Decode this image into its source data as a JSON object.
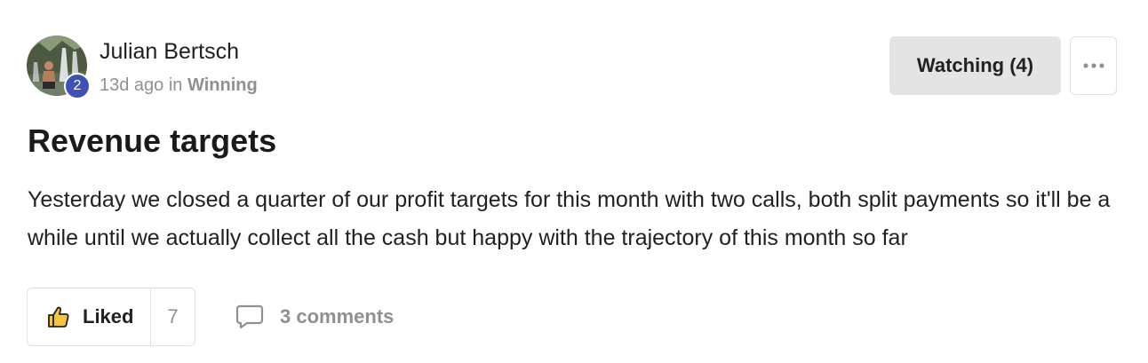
{
  "post": {
    "author": {
      "name": "Julian Bertsch",
      "level": "2",
      "avatar": "waterfall-photo-avatar"
    },
    "meta": {
      "time": "13d ago",
      "in_word": "in",
      "category": "Winning"
    },
    "actions": {
      "watching_label": "Watching (4)",
      "more_icon": "ellipsis-icon"
    },
    "title": "Revenue targets",
    "body": "Yesterday we closed a quarter of our profit targets for this month with two calls, both split payments so it'll be a while until we actually collect all the cash but happy with the trajectory of this month so far",
    "footer": {
      "like_icon": "thumbs-up-icon",
      "like_label": "Liked",
      "like_count": "7",
      "comment_icon": "comment-bubble-icon",
      "comments_label": "3 comments"
    },
    "colors": {
      "level_badge": "#3f51b5",
      "like_icon_fill": "#f5c542",
      "muted_text": "#909090",
      "watch_button_bg": "#e4e4e4"
    }
  }
}
